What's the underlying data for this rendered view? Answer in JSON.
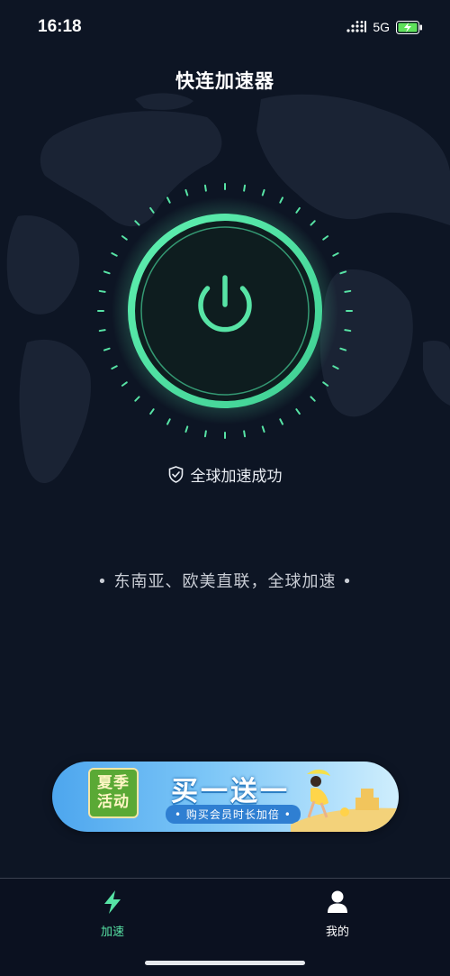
{
  "status_bar": {
    "time": "16:18",
    "network": "5G"
  },
  "app": {
    "title": "快连加速器"
  },
  "connection": {
    "status_text": "全球加速成功",
    "tagline": "• 东南亚、欧美直联，全球加速 •",
    "connected": true
  },
  "promo": {
    "badge_line1": "夏季",
    "badge_line2": "活动",
    "title": "买一送一",
    "subtitle": "• 购买会员时长加倍 •"
  },
  "tabs": [
    {
      "label": "加速",
      "icon": "lightning-icon",
      "active": true
    },
    {
      "label": "我的",
      "icon": "user-icon",
      "active": false
    }
  ],
  "colors": {
    "accent": "#57e3a5",
    "background": "#0d1524",
    "inactive_tab": "#ffffff"
  }
}
